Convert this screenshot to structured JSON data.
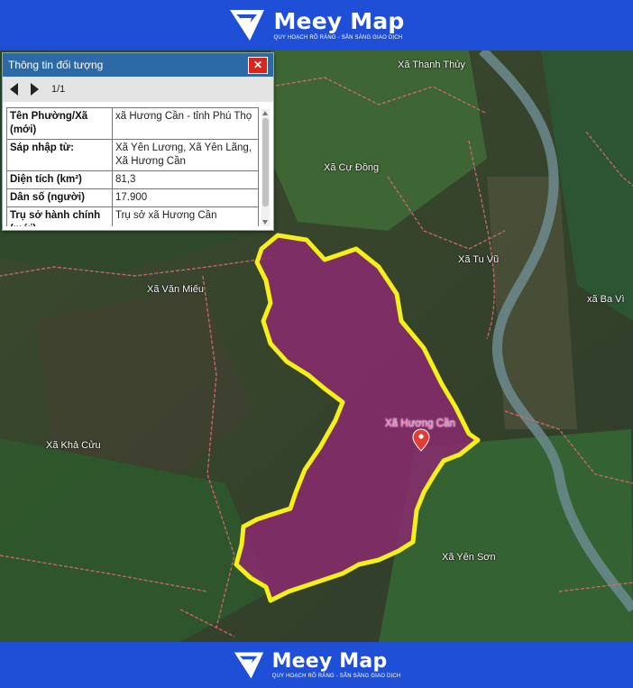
{
  "brand": {
    "name": "Meey Map",
    "tagline": "QUY HOẠCH RÕ RÀNG - SẴN SÀNG GIAO DỊCH"
  },
  "colors": {
    "band": "#1f4fd6",
    "boundary": "#f5ef1a",
    "fill": "#8a2a6e",
    "popup_header": "#2b6aa6",
    "close": "#d9261c"
  },
  "popup": {
    "title": "Thông tin đối tượng",
    "close_icon": "close-icon",
    "pager": "1/1",
    "rows": [
      {
        "key": "Tên Phường/Xã (mới)",
        "value": "xã Hương Cần - tỉnh Phú Thọ"
      },
      {
        "key": "Sáp nhập từ:",
        "value": "Xã Yên Lương, Xã Yên Lãng, Xã Hương Cần"
      },
      {
        "key": "Diện tích (km²)",
        "value": "81,3"
      },
      {
        "key": "Dân số (người)",
        "value": "17.900"
      },
      {
        "key": "Trụ sở hành chính (mới)",
        "value": "Trụ sở xã Hương Cần"
      }
    ]
  },
  "map": {
    "selected": "Xã Hương Cần",
    "labels": {
      "thanh_thuy": "Xã Thanh Thủy",
      "cu_dong": "Xã Cự Đồng",
      "tu_vu": "Xã Tu Vũ",
      "ba_vi": "xã Ba Vì",
      "van_mieu": "Xã Văn Miếu",
      "kha_cuu": "Xã Khả Cửu",
      "huong_can": "Xã Hương Cần",
      "yen_son": "Xã Yên Sơn"
    }
  }
}
